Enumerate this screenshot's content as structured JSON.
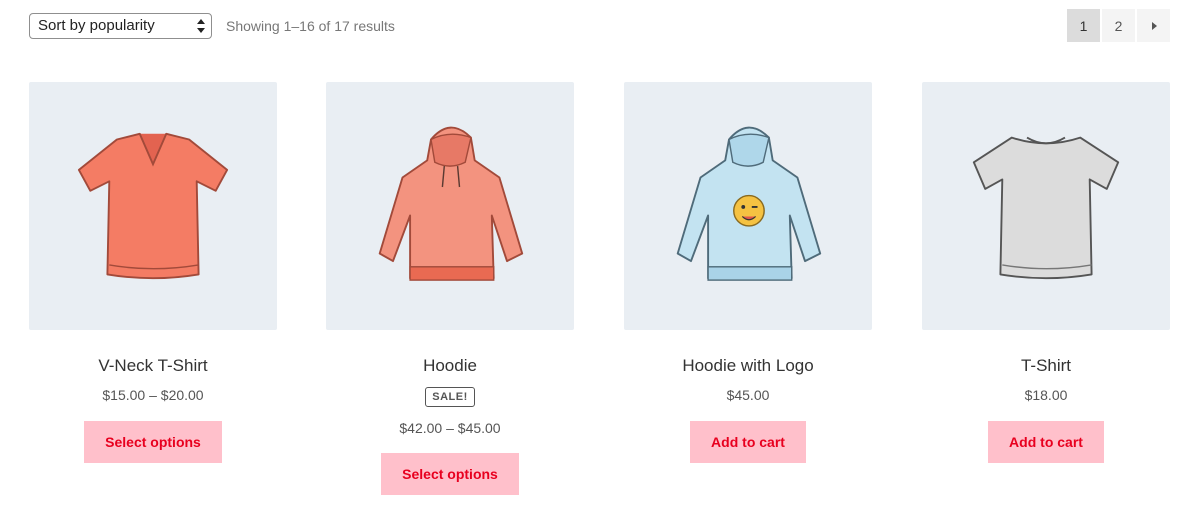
{
  "toolbar": {
    "sort_selected": "Sort by popularity",
    "result_count": "Showing 1–16 of 17 results"
  },
  "pagination": {
    "pages": [
      "1",
      "2"
    ],
    "current": "1",
    "next_icon": "triangle-right-icon"
  },
  "products": [
    {
      "title": "V-Neck T-Shirt",
      "price": "$15.00 – $20.00",
      "button": "Select options",
      "image": "vneck-tshirt-coral",
      "color": "#f47c64"
    },
    {
      "title": "Hoodie",
      "badge": "SALE!",
      "price": "$42.00 – $45.00",
      "button": "Select options",
      "image": "hoodie-coral",
      "color": "#f09080"
    },
    {
      "title": "Hoodie with Logo",
      "price": "$45.00",
      "button": "Add to cart",
      "image": "hoodie-blue-emoji-logo",
      "color": "#bfe2f0"
    },
    {
      "title": "T-Shirt",
      "price": "$18.00",
      "button": "Add to cart",
      "image": "tshirt-grey",
      "color": "#d9d9d9"
    }
  ],
  "colors": {
    "button_bg": "#ffc0cb",
    "button_text": "#e8001f",
    "image_bg": "#e9eef3"
  }
}
